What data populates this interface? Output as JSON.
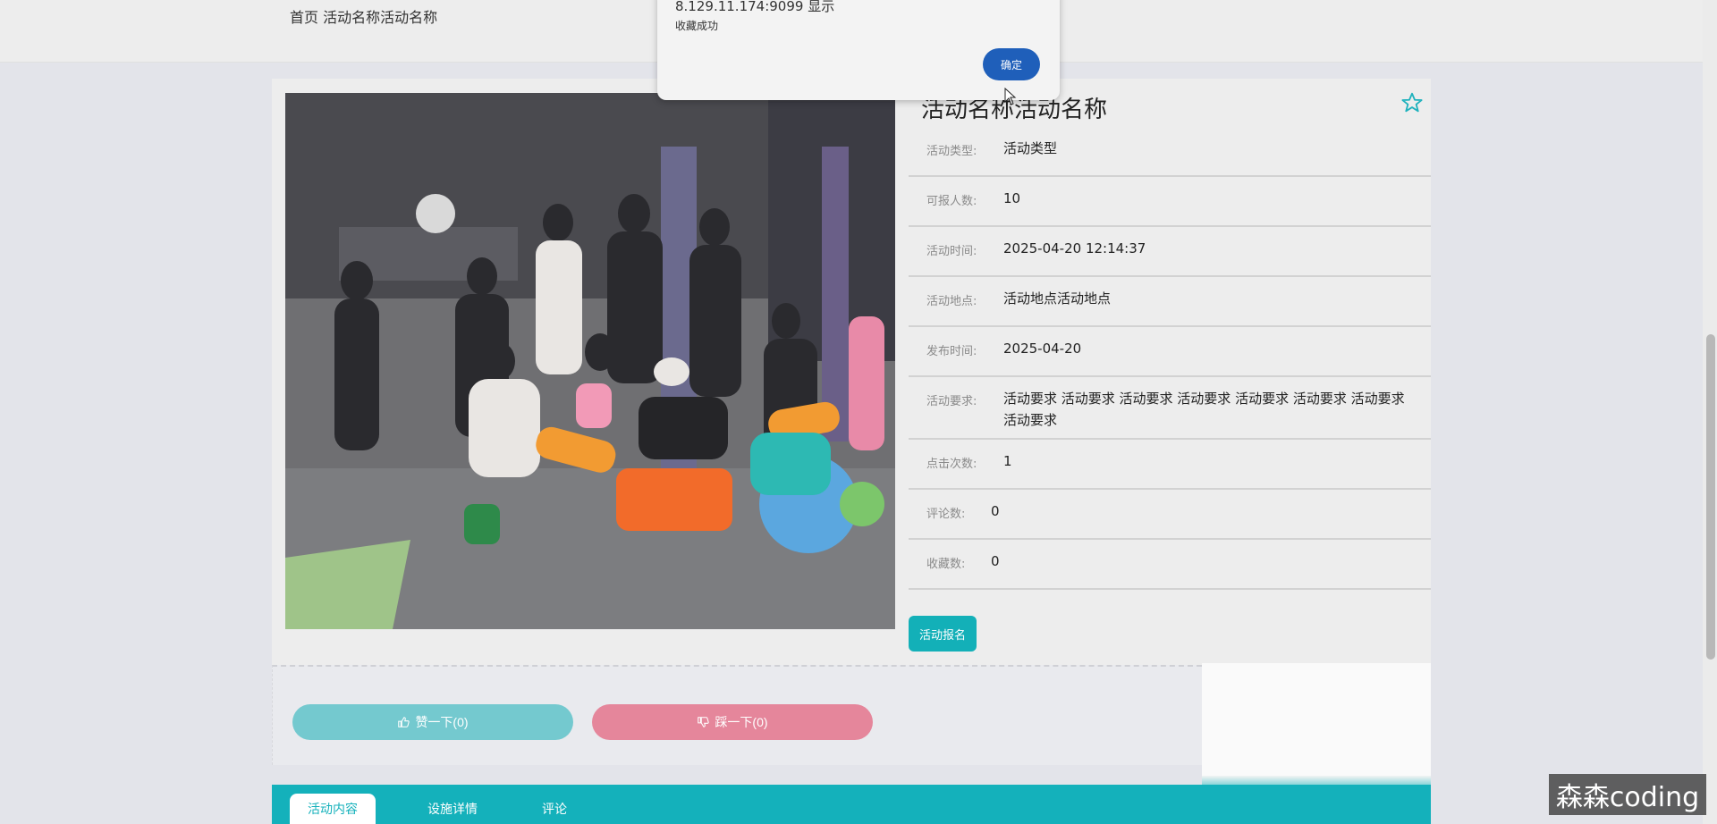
{
  "breadcrumb": {
    "home": "首页",
    "current": "活动名称活动名称"
  },
  "detail": {
    "title": "活动名称活动名称",
    "favorite_icon": "star-outline-icon",
    "fields": [
      {
        "label": "活动类型:",
        "value": "活动类型"
      },
      {
        "label": "可报人数:",
        "value": "10"
      },
      {
        "label": "活动时间:",
        "value": "2025-04-20 12:14:37"
      },
      {
        "label": "活动地点:",
        "value": "活动地点活动地点"
      },
      {
        "label": "发布时间:",
        "value": "2025-04-20"
      },
      {
        "label": "活动要求:",
        "value": "活动要求 活动要求 活动要求 活动要求 活动要求 活动要求 活动要求 活动要求"
      },
      {
        "label": "点击次数:",
        "value": "1"
      },
      {
        "label": "评论数:",
        "value": "0"
      },
      {
        "label": "收藏数:",
        "value": "0"
      }
    ],
    "signup_label": "活动报名"
  },
  "votes": {
    "like_label": "赞一下(0)",
    "dislike_label": "踩一下(0)"
  },
  "tabs": [
    {
      "label": "活动内容",
      "active": true
    },
    {
      "label": "设施详情",
      "active": false
    },
    {
      "label": "评论",
      "active": false
    }
  ],
  "dialog": {
    "origin": "8.129.11.174:9099 显示",
    "message": "收藏成功",
    "ok_label": "确定"
  },
  "watermark": "森森coding",
  "colors": {
    "teal": "#14b1bb",
    "like": "#74c9cf",
    "dislike": "#e5869b",
    "dialog_button": "#1f5fba"
  }
}
